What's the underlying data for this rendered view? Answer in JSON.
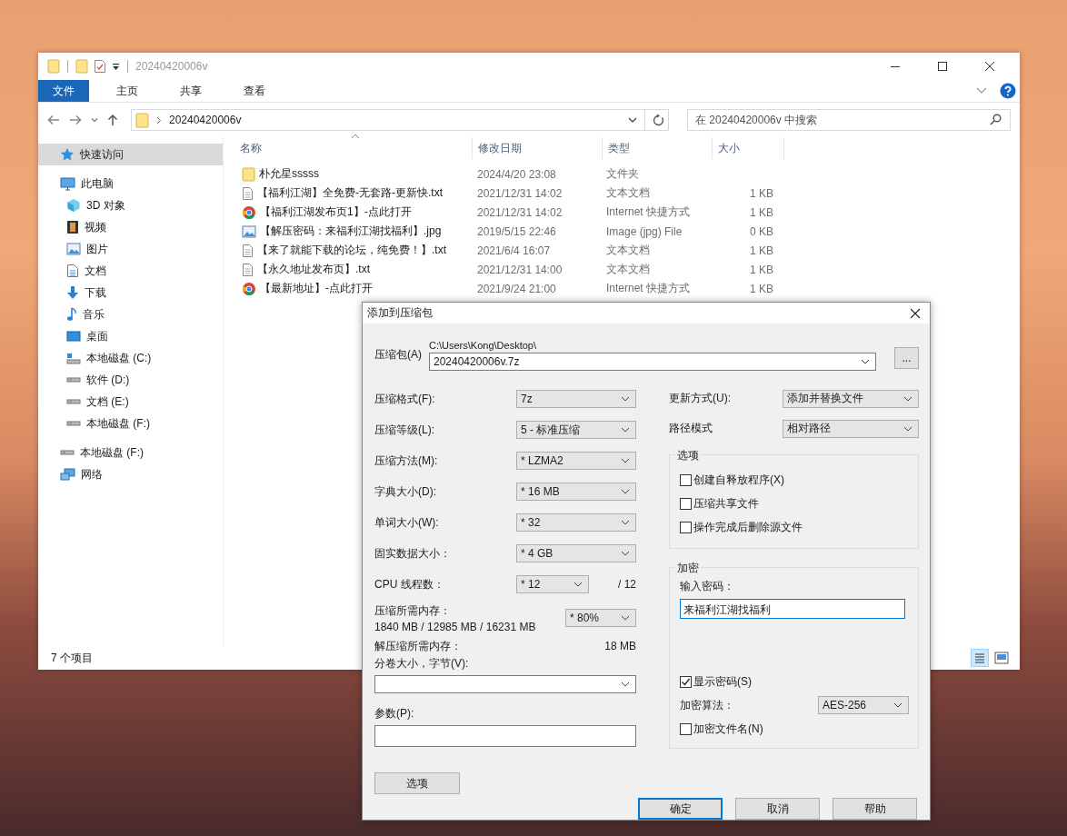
{
  "explorer": {
    "title": "20240420006v",
    "ribbon_tabs": [
      {
        "label": "文件",
        "selected": true
      },
      {
        "label": "主页",
        "selected": false
      },
      {
        "label": "共享",
        "selected": false
      },
      {
        "label": "查看",
        "selected": false
      }
    ],
    "address": {
      "path": "20240420006v"
    },
    "search": {
      "placeholder": "在 20240420006v 中搜索"
    },
    "sidebar": {
      "items": [
        {
          "label": "快速访问",
          "kind": "star",
          "selected": true
        },
        {
          "label": "此电脑",
          "kind": "pc",
          "selected": false,
          "children": [
            {
              "label": "3D 对象",
              "kind": "cube",
              "selected": false
            },
            {
              "label": "视频",
              "kind": "film",
              "selected": false
            },
            {
              "label": "图片",
              "kind": "picture",
              "selected": false
            },
            {
              "label": "文档",
              "kind": "doc",
              "selected": false
            },
            {
              "label": "下载",
              "kind": "download",
              "selected": false
            },
            {
              "label": "音乐",
              "kind": "music",
              "selected": false
            },
            {
              "label": "桌面",
              "kind": "desktop",
              "selected": false
            },
            {
              "label": "本地磁盘 (C:)",
              "kind": "system-drive",
              "selected": false
            },
            {
              "label": "软件 (D:)",
              "kind": "drive",
              "selected": false
            },
            {
              "label": "文档 (E:)",
              "kind": "drive",
              "selected": false
            },
            {
              "label": "本地磁盘 (F:)",
              "kind": "drive",
              "selected": false
            }
          ]
        },
        {
          "label": "本地磁盘 (F:)",
          "kind": "drive",
          "selected": false
        },
        {
          "label": "网络",
          "kind": "network",
          "selected": false
        }
      ]
    },
    "table": {
      "columns": [
        "名称",
        "修改日期",
        "类型",
        "大小"
      ],
      "rows": [
        {
          "kind": "folder",
          "name": "朴允星sssss",
          "date": "2024/4/20 23:08",
          "type": "文件夹"
        },
        {
          "kind": "text",
          "name": "【福利江湖】全免费-无套路-更新快.txt",
          "date": "2021/12/31 14:02",
          "type": "文本文档",
          "size": "1 KB"
        },
        {
          "kind": "shortcut",
          "name": "【福利江湖发布页1】-点此打开",
          "date": "2021/12/31 14:02",
          "type": "Internet 快捷方式",
          "size": "1 KB"
        },
        {
          "kind": "image",
          "name": "【解压密码：来福利江湖找福利】.jpg",
          "date": "2019/5/15 22:46",
          "type": "Image (jpg) File",
          "size": "0 KB"
        },
        {
          "kind": "text",
          "name": "【来了就能下载的论坛，纯免费！】.txt",
          "date": "2021/6/4 16:07",
          "type": "文本文档",
          "size": "1 KB"
        },
        {
          "kind": "text",
          "name": "【永久地址发布页】.txt",
          "date": "2021/12/31 14:00",
          "type": "文本文档",
          "size": "1 KB"
        },
        {
          "kind": "shortcut",
          "name": "【最新地址】-点此打开",
          "date": "2021/9/24 21:00",
          "type": "Internet 快捷方式",
          "size": "1 KB"
        }
      ]
    },
    "status_bar": "7 个项目"
  },
  "dialog": {
    "title": "添加到压缩包",
    "archive": {
      "label": "压缩包(A)",
      "folder": "C:\\Users\\Kong\\Desktop\\",
      "value": "20240420006v.7z",
      "browse": "..."
    },
    "left_rows": [
      {
        "kind": "select",
        "label": "压缩格式(F):",
        "value": "7z"
      },
      {
        "kind": "select",
        "label": "压缩等级(L):",
        "value": "5 - 标准压缩"
      },
      {
        "kind": "select",
        "label": "压缩方法(M):",
        "value": "* LZMA2"
      },
      {
        "kind": "select",
        "label": "字典大小(D):",
        "value": "* 16 MB"
      },
      {
        "kind": "select",
        "label": "单词大小(W):",
        "value": "* 32"
      },
      {
        "kind": "select",
        "label": "固实数据大小：",
        "value": "* 4 GB"
      },
      {
        "kind": "threads",
        "label": "CPU 线程数：",
        "value": "* 12",
        "suffix": "/ 12"
      },
      {
        "kind": "memory",
        "label": "压缩所需内存：",
        "detail": "1840 MB / 12985 MB / 16231 MB",
        "value": "* 80%"
      },
      {
        "kind": "info",
        "label": "解压缩所需内存：",
        "value": "18 MB"
      }
    ],
    "volume": {
      "label": "分卷大小，字节(V):"
    },
    "params": {
      "label": "参数(P):"
    },
    "options_button": "选项",
    "update": {
      "label": "更新方式(U):",
      "value": "添加并替换文件"
    },
    "path_mode": {
      "label": "路径模式",
      "value": "相对路径"
    },
    "options_group": {
      "title": "选项",
      "checkboxes": [
        {
          "label": "创建自释放程序(X)",
          "checked": false
        },
        {
          "label": "压缩共享文件",
          "checked": false
        },
        {
          "label": "操作完成后删除源文件",
          "checked": false
        }
      ]
    },
    "encryption": {
      "title": "加密",
      "password_label": "输入密码：",
      "password": "来福利江湖找福利",
      "show_password": {
        "label": "显示密码(S)",
        "checked": true
      },
      "method_label": "加密算法：",
      "method": "AES-256",
      "encrypt_names": {
        "label": "加密文件名(N)",
        "checked": false
      }
    },
    "buttons": [
      {
        "label": "确定",
        "default": true
      },
      {
        "label": "取消",
        "default": false
      },
      {
        "label": "帮助",
        "default": false
      }
    ]
  }
}
